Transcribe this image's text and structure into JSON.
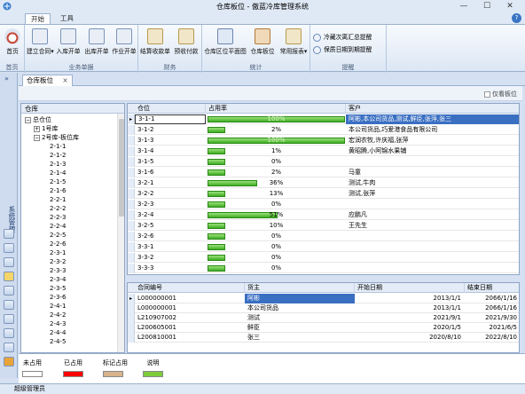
{
  "window": {
    "title": "仓库板位 - 傲蓝冷库管理系统",
    "min": "—",
    "max": "☐",
    "close": "✕"
  },
  "ribbon": {
    "tabs": [
      "开始",
      "工具"
    ],
    "groups": [
      {
        "caption": "首页",
        "buttons": [
          "首页"
        ]
      },
      {
        "caption": "业务单据",
        "buttons": [
          "建立合同",
          "入库开单",
          "出库开单",
          "作业开单"
        ]
      },
      {
        "caption": "财务",
        "buttons": [
          "结算收款单",
          "预收付款"
        ]
      },
      {
        "caption": "统计",
        "buttons": [
          "仓库区位平面图",
          "仓库板位",
          "常用报表"
        ]
      },
      {
        "caption": "提醒",
        "buttons": [
          "冷藏次离汇总提醒",
          "保质日期到期提醒"
        ]
      }
    ]
  },
  "sidebar": {
    "label": "系统管理",
    "collapse": "»"
  },
  "doc_tab": {
    "label": "仓库板位",
    "close": "×"
  },
  "toolbar": {
    "only_free": "仅看板位"
  },
  "tree": {
    "header": "仓库",
    "nodes": [
      {
        "label": "总仓位",
        "level": 0,
        "box": "−"
      },
      {
        "label": "1号库",
        "level": 1,
        "box": "+"
      },
      {
        "label": "2号库-板位库",
        "level": 1,
        "box": "−"
      },
      {
        "label": "2-1-1",
        "level": 2
      },
      {
        "label": "2-1-2",
        "level": 2
      },
      {
        "label": "2-1-3",
        "level": 2
      },
      {
        "label": "2-1-4",
        "level": 2
      },
      {
        "label": "2-1-5",
        "level": 2
      },
      {
        "label": "2-1-6",
        "level": 2
      },
      {
        "label": "2-2-1",
        "level": 2
      },
      {
        "label": "2-2-2",
        "level": 2
      },
      {
        "label": "2-2-3",
        "level": 2
      },
      {
        "label": "2-2-4",
        "level": 2
      },
      {
        "label": "2-2-5",
        "level": 2
      },
      {
        "label": "2-2-6",
        "level": 2
      },
      {
        "label": "2-3-1",
        "level": 2
      },
      {
        "label": "2-3-2",
        "level": 2
      },
      {
        "label": "2-3-3",
        "level": 2
      },
      {
        "label": "2-3-4",
        "level": 2
      },
      {
        "label": "2-3-5",
        "level": 2
      },
      {
        "label": "2-3-6",
        "level": 2
      },
      {
        "label": "2-4-1",
        "level": 2
      },
      {
        "label": "2-4-2",
        "level": 2
      },
      {
        "label": "2-4-3",
        "level": 2
      },
      {
        "label": "2-4-4",
        "level": 2
      },
      {
        "label": "2-4-5",
        "level": 2
      }
    ]
  },
  "grid": {
    "headers": [
      "仓位",
      "占用率",
      "客户"
    ],
    "rows": [
      {
        "pos": "3-1-1",
        "pct": 100,
        "pct_label": "100%",
        "customer": "阿彬,本公司货品,测试,鲜臣,张萍,张三",
        "selected": true
      },
      {
        "pos": "3-1-2",
        "pct": 2,
        "pct_label": "2%",
        "customer": "本公司货品,巧爱港食品有限公司"
      },
      {
        "pos": "3-1-3",
        "pct": 100,
        "pct_label": "100%",
        "customer": "宏润农牧,许庆福,张萍"
      },
      {
        "pos": "3-1-4",
        "pct": 1,
        "pct_label": "1%",
        "customer": "黄昭腾,小阿锦水果铺"
      },
      {
        "pos": "3-1-5",
        "pct": 0,
        "pct_label": "0%",
        "customer": ""
      },
      {
        "pos": "3-1-6",
        "pct": 2,
        "pct_label": "2%",
        "customer": "马童"
      },
      {
        "pos": "3-2-1",
        "pct": 36,
        "pct_label": "36%",
        "customer": "测试,牛肉"
      },
      {
        "pos": "3-2-2",
        "pct": 13,
        "pct_label": "13%",
        "customer": "测试,张萍"
      },
      {
        "pos": "3-2-3",
        "pct": 0,
        "pct_label": "0%",
        "customer": ""
      },
      {
        "pos": "3-2-4",
        "pct": 51,
        "pct_label": "51%",
        "customer": "应鹏凡"
      },
      {
        "pos": "3-2-5",
        "pct": 10,
        "pct_label": "10%",
        "customer": "王先生"
      },
      {
        "pos": "3-2-6",
        "pct": 0,
        "pct_label": "0%",
        "customer": ""
      },
      {
        "pos": "3-3-1",
        "pct": 0,
        "pct_label": "0%",
        "customer": ""
      },
      {
        "pos": "3-3-2",
        "pct": 0,
        "pct_label": "0%",
        "customer": ""
      },
      {
        "pos": "3-3-3",
        "pct": 0,
        "pct_label": "0%",
        "customer": ""
      }
    ]
  },
  "contracts": {
    "headers": [
      "合同编号",
      "货主",
      "开始日期",
      "结束日期"
    ],
    "rows": [
      {
        "no": "L000000001",
        "owner": "阿彬",
        "start": "2013/1/1",
        "end": "2066/1/16",
        "selected": true
      },
      {
        "no": "L000000001",
        "owner": "本公司货品",
        "start": "2013/1/1",
        "end": "2066/1/16"
      },
      {
        "no": "L210907002",
        "owner": "测试",
        "start": "2021/9/1",
        "end": "2021/9/30"
      },
      {
        "no": "L200605001",
        "owner": "鲜臣",
        "start": "2020/1/5",
        "end": "2021/6/5"
      },
      {
        "no": "L200810001",
        "owner": "张三",
        "start": "2020/8/10",
        "end": "2022/8/10"
      }
    ]
  },
  "legend": [
    {
      "label": "未占用",
      "color": "#ffffff"
    },
    {
      "label": "已占用",
      "color": "#ff0000"
    },
    {
      "label": "标记占用",
      "color": "#d8b48a"
    },
    {
      "label": "说明",
      "color": "#7ecb3a"
    }
  ],
  "status": {
    "user": "超级管理员"
  }
}
